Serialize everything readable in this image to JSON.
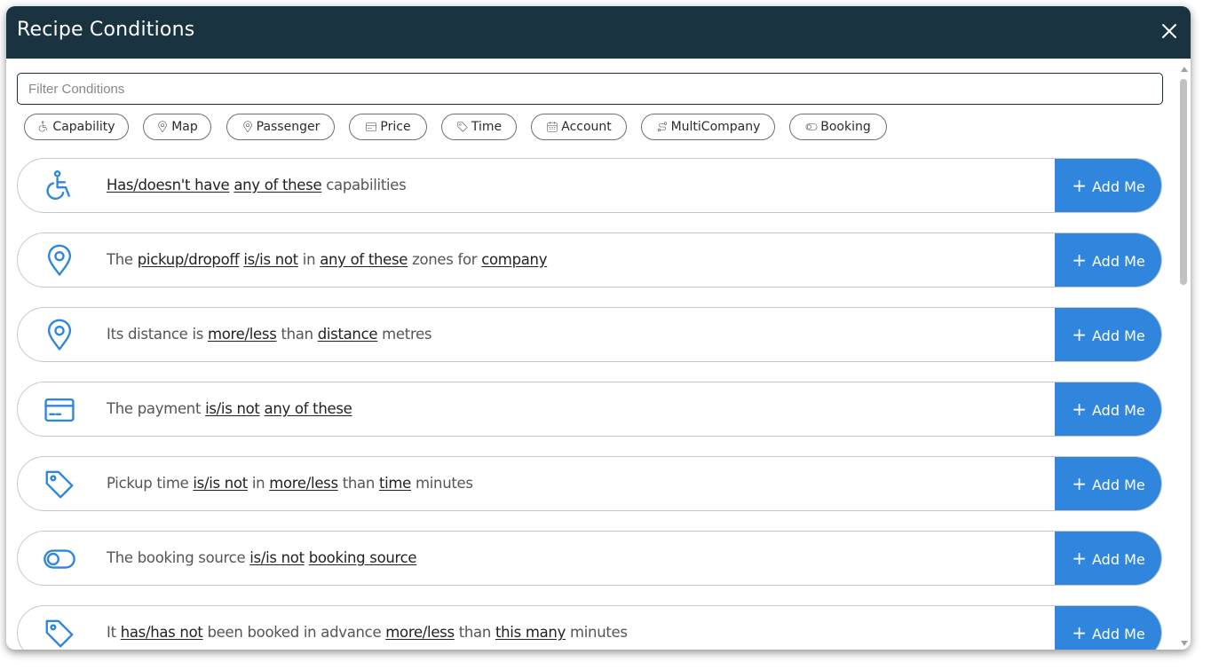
{
  "dialog": {
    "title": "Recipe Conditions",
    "close_icon": "close-icon"
  },
  "filter": {
    "placeholder": "Filter Conditions",
    "value": ""
  },
  "chips": [
    {
      "label": "Capability",
      "icon": "wheelchair-icon"
    },
    {
      "label": "Map",
      "icon": "map-pin-icon"
    },
    {
      "label": "Passenger",
      "icon": "map-pin-icon"
    },
    {
      "label": "Price",
      "icon": "credit-card-icon"
    },
    {
      "label": "Time",
      "icon": "tag-icon"
    },
    {
      "label": "Account",
      "icon": "calendar-icon"
    },
    {
      "label": "MultiCompany",
      "icon": "route-icon"
    },
    {
      "label": "Booking",
      "icon": "toggle-icon"
    }
  ],
  "add_label": "Add Me",
  "conditions": [
    {
      "icon": "wheelchair-icon",
      "parts": [
        {
          "t": "Has/doesn't have",
          "link": true
        },
        {
          "t": " "
        },
        {
          "t": "any of these",
          "link": true
        },
        {
          "t": " capabilities"
        }
      ]
    },
    {
      "icon": "map-pin-icon",
      "parts": [
        {
          "t": "The "
        },
        {
          "t": "pickup/dropoff",
          "link": true
        },
        {
          "t": " "
        },
        {
          "t": "is/is not",
          "link": true
        },
        {
          "t": " in "
        },
        {
          "t": "any of these",
          "link": true
        },
        {
          "t": " zones for "
        },
        {
          "t": "company",
          "link": true
        }
      ]
    },
    {
      "icon": "map-pin-icon",
      "parts": [
        {
          "t": "Its distance is "
        },
        {
          "t": "more/less",
          "link": true
        },
        {
          "t": " than "
        },
        {
          "t": "distance",
          "link": true
        },
        {
          "t": " metres"
        }
      ]
    },
    {
      "icon": "credit-card-icon",
      "parts": [
        {
          "t": "The payment "
        },
        {
          "t": "is/is not",
          "link": true
        },
        {
          "t": " "
        },
        {
          "t": "any of these",
          "link": true
        }
      ]
    },
    {
      "icon": "tag-icon",
      "parts": [
        {
          "t": "Pickup time "
        },
        {
          "t": "is/is not",
          "link": true
        },
        {
          "t": " in "
        },
        {
          "t": "more/less",
          "link": true
        },
        {
          "t": " than "
        },
        {
          "t": "time",
          "link": true
        },
        {
          "t": " minutes"
        }
      ]
    },
    {
      "icon": "toggle-icon",
      "parts": [
        {
          "t": "The booking source "
        },
        {
          "t": "is/is not",
          "link": true
        },
        {
          "t": " "
        },
        {
          "t": "booking source",
          "link": true
        }
      ]
    },
    {
      "icon": "tag-icon",
      "parts": [
        {
          "t": "It "
        },
        {
          "t": "has/has not",
          "link": true
        },
        {
          "t": " been booked in advance "
        },
        {
          "t": "more/less",
          "link": true
        },
        {
          "t": " than "
        },
        {
          "t": "this many",
          "link": true
        },
        {
          "t": " minutes"
        }
      ]
    }
  ],
  "colors": {
    "header_bg": "#1a3340",
    "accent": "#2f86dc",
    "icon": "#2f86dc"
  }
}
